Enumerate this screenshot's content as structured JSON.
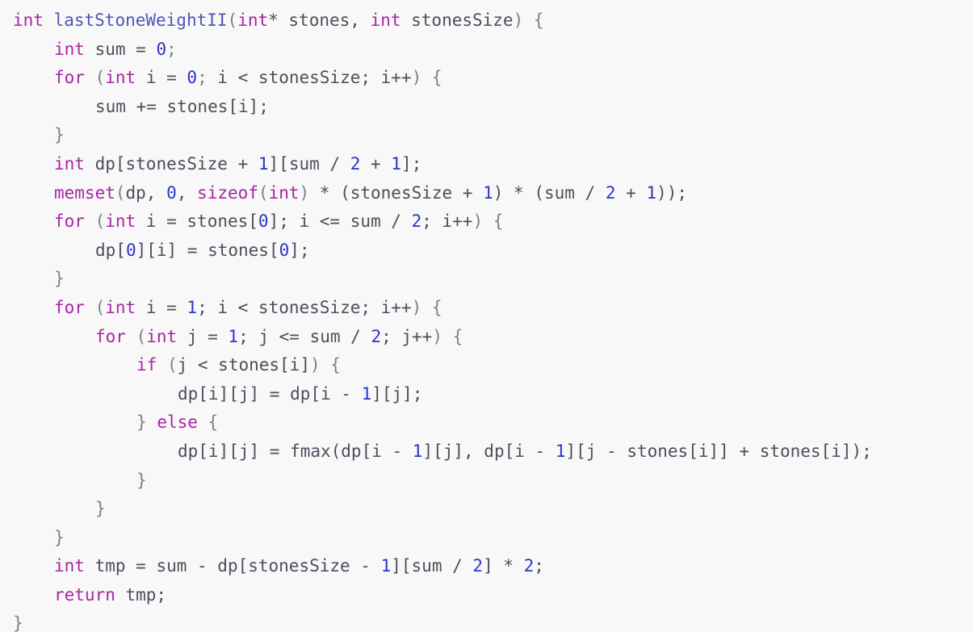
{
  "editor": {
    "background": "#f8f8f8",
    "colors": {
      "keyword": "#a626a4",
      "number": "#2a35c8",
      "function": "#4f55b8",
      "punctuation": "#7a7f8a",
      "identifier": "#4a4f5c"
    },
    "lines": [
      {
        "indent": 0,
        "tokens": [
          {
            "t": "kw",
            "v": "int"
          },
          {
            "t": "id",
            "v": " "
          },
          {
            "t": "fn",
            "v": "lastStoneWeightII"
          },
          {
            "t": "punc",
            "v": "("
          },
          {
            "t": "kw",
            "v": "int"
          },
          {
            "t": "id",
            "v": "* stones, "
          },
          {
            "t": "kw",
            "v": "int"
          },
          {
            "t": "id",
            "v": " stonesSize"
          },
          {
            "t": "punc",
            "v": ") {"
          }
        ]
      },
      {
        "indent": 1,
        "tokens": [
          {
            "t": "kw",
            "v": "int"
          },
          {
            "t": "id",
            "v": " sum = "
          },
          {
            "t": "num",
            "v": "0"
          },
          {
            "t": "punc",
            "v": ";"
          }
        ]
      },
      {
        "indent": 1,
        "tokens": [
          {
            "t": "kw",
            "v": "for"
          },
          {
            "t": "id",
            "v": " "
          },
          {
            "t": "punc",
            "v": "("
          },
          {
            "t": "kw",
            "v": "int"
          },
          {
            "t": "id",
            "v": " i = "
          },
          {
            "t": "num",
            "v": "0"
          },
          {
            "t": "punc",
            "v": ";"
          },
          {
            "t": "id",
            "v": " i < stonesSize; i++"
          },
          {
            "t": "punc",
            "v": ") {"
          }
        ]
      },
      {
        "indent": 2,
        "tokens": [
          {
            "t": "id",
            "v": "sum += stones[i];"
          }
        ]
      },
      {
        "indent": 1,
        "tokens": [
          {
            "t": "punc",
            "v": "}"
          }
        ]
      },
      {
        "indent": 1,
        "tokens": [
          {
            "t": "kw",
            "v": "int"
          },
          {
            "t": "id",
            "v": " dp[stonesSize + "
          },
          {
            "t": "num",
            "v": "1"
          },
          {
            "t": "id",
            "v": "][sum / "
          },
          {
            "t": "num",
            "v": "2"
          },
          {
            "t": "id",
            "v": " + "
          },
          {
            "t": "num",
            "v": "1"
          },
          {
            "t": "id",
            "v": "];"
          }
        ]
      },
      {
        "indent": 1,
        "tokens": [
          {
            "t": "kw",
            "v": "memset"
          },
          {
            "t": "punc",
            "v": "("
          },
          {
            "t": "id",
            "v": "dp, "
          },
          {
            "t": "num",
            "v": "0"
          },
          {
            "t": "id",
            "v": ", "
          },
          {
            "t": "kw",
            "v": "sizeof"
          },
          {
            "t": "punc",
            "v": "("
          },
          {
            "t": "kw",
            "v": "int"
          },
          {
            "t": "punc",
            "v": ")"
          },
          {
            "t": "id",
            "v": " * (stonesSize + "
          },
          {
            "t": "num",
            "v": "1"
          },
          {
            "t": "id",
            "v": ") * (sum / "
          },
          {
            "t": "num",
            "v": "2"
          },
          {
            "t": "id",
            "v": " + "
          },
          {
            "t": "num",
            "v": "1"
          },
          {
            "t": "id",
            "v": "));"
          }
        ]
      },
      {
        "indent": 1,
        "tokens": [
          {
            "t": "kw",
            "v": "for"
          },
          {
            "t": "id",
            "v": " "
          },
          {
            "t": "punc",
            "v": "("
          },
          {
            "t": "kw",
            "v": "int"
          },
          {
            "t": "id",
            "v": " i = stones["
          },
          {
            "t": "num",
            "v": "0"
          },
          {
            "t": "id",
            "v": "]; i <= sum / "
          },
          {
            "t": "num",
            "v": "2"
          },
          {
            "t": "id",
            "v": "; i++"
          },
          {
            "t": "punc",
            "v": ") {"
          }
        ]
      },
      {
        "indent": 2,
        "tokens": [
          {
            "t": "id",
            "v": "dp["
          },
          {
            "t": "num",
            "v": "0"
          },
          {
            "t": "id",
            "v": "][i] = stones["
          },
          {
            "t": "num",
            "v": "0"
          },
          {
            "t": "id",
            "v": "];"
          }
        ]
      },
      {
        "indent": 1,
        "tokens": [
          {
            "t": "punc",
            "v": "}"
          }
        ]
      },
      {
        "indent": 1,
        "tokens": [
          {
            "t": "kw",
            "v": "for"
          },
          {
            "t": "id",
            "v": " "
          },
          {
            "t": "punc",
            "v": "("
          },
          {
            "t": "kw",
            "v": "int"
          },
          {
            "t": "id",
            "v": " i = "
          },
          {
            "t": "num",
            "v": "1"
          },
          {
            "t": "id",
            "v": "; i < stonesSize; i++"
          },
          {
            "t": "punc",
            "v": ") {"
          }
        ]
      },
      {
        "indent": 2,
        "tokens": [
          {
            "t": "kw",
            "v": "for"
          },
          {
            "t": "id",
            "v": " "
          },
          {
            "t": "punc",
            "v": "("
          },
          {
            "t": "kw",
            "v": "int"
          },
          {
            "t": "id",
            "v": " j = "
          },
          {
            "t": "num",
            "v": "1"
          },
          {
            "t": "id",
            "v": "; j <= sum / "
          },
          {
            "t": "num",
            "v": "2"
          },
          {
            "t": "id",
            "v": "; j++"
          },
          {
            "t": "punc",
            "v": ") {"
          }
        ]
      },
      {
        "indent": 3,
        "tokens": [
          {
            "t": "kw",
            "v": "if"
          },
          {
            "t": "id",
            "v": " "
          },
          {
            "t": "punc",
            "v": "("
          },
          {
            "t": "id",
            "v": "j < stones[i]"
          },
          {
            "t": "punc",
            "v": ") {"
          }
        ]
      },
      {
        "indent": 4,
        "tokens": [
          {
            "t": "id",
            "v": "dp[i][j] = dp[i - "
          },
          {
            "t": "num",
            "v": "1"
          },
          {
            "t": "id",
            "v": "][j];"
          }
        ]
      },
      {
        "indent": 3,
        "tokens": [
          {
            "t": "punc",
            "v": "}"
          },
          {
            "t": "id",
            "v": " "
          },
          {
            "t": "kw",
            "v": "else"
          },
          {
            "t": "id",
            "v": " "
          },
          {
            "t": "punc",
            "v": "{"
          }
        ]
      },
      {
        "indent": 4,
        "tokens": [
          {
            "t": "id",
            "v": "dp[i][j] = fmax(dp[i - "
          },
          {
            "t": "num",
            "v": "1"
          },
          {
            "t": "id",
            "v": "][j], dp[i - "
          },
          {
            "t": "num",
            "v": "1"
          },
          {
            "t": "id",
            "v": "][j - stones[i]] + stones[i]);"
          }
        ]
      },
      {
        "indent": 3,
        "tokens": [
          {
            "t": "punc",
            "v": "}"
          }
        ]
      },
      {
        "indent": 2,
        "tokens": [
          {
            "t": "punc",
            "v": "}"
          }
        ]
      },
      {
        "indent": 1,
        "tokens": [
          {
            "t": "punc",
            "v": "}"
          }
        ]
      },
      {
        "indent": 1,
        "tokens": [
          {
            "t": "kw",
            "v": "int"
          },
          {
            "t": "id",
            "v": " tmp = sum - dp[stonesSize - "
          },
          {
            "t": "num",
            "v": "1"
          },
          {
            "t": "id",
            "v": "][sum / "
          },
          {
            "t": "num",
            "v": "2"
          },
          {
            "t": "id",
            "v": "] * "
          },
          {
            "t": "num",
            "v": "2"
          },
          {
            "t": "id",
            "v": ";"
          }
        ]
      },
      {
        "indent": 1,
        "tokens": [
          {
            "t": "kw",
            "v": "return"
          },
          {
            "t": "id",
            "v": " tmp;"
          }
        ]
      },
      {
        "indent": 0,
        "tokens": [
          {
            "t": "punc",
            "v": "}"
          }
        ]
      }
    ]
  }
}
